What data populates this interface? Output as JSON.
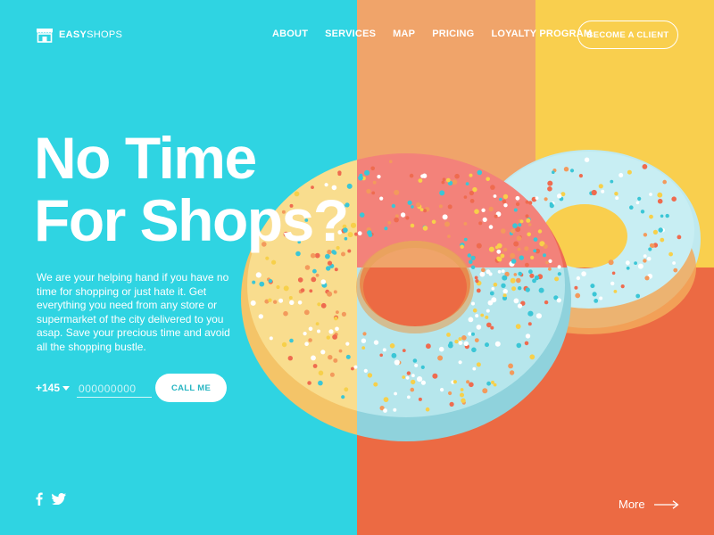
{
  "brand": {
    "name_bold": "EASY",
    "name_light": "SHOPS",
    "icon": "storefront-icon"
  },
  "nav": {
    "items": [
      {
        "label": "ABOUT"
      },
      {
        "label": "SERVICES"
      },
      {
        "label": "MAP"
      },
      {
        "label": "PRICING"
      },
      {
        "label": "LOYALTY PROGRAM"
      }
    ],
    "cta_label": "BECOME A CLIENT"
  },
  "hero": {
    "title_line1": "No Time",
    "title_line2": "For Shops?",
    "description": "We are your helping hand if you have no time for shopping or just hate it. Get everything you need from any store or supermarket of the city delivered to you asap. Save your precious time and avoid all the shopping bustle."
  },
  "phone": {
    "country_code": "+145",
    "placeholder": "000000000",
    "call_label": "CALL ME"
  },
  "social": {
    "icons": [
      "facebook-icon",
      "twitter-icon"
    ]
  },
  "footer": {
    "more_label": "More",
    "more_icon": "arrow-right-icon"
  },
  "colors": {
    "cyan": "#2fd4e2",
    "peach": "#f0a46a",
    "yellow": "#f9cf4e",
    "red": "#ec6a43",
    "button_text": "#27b5c2"
  }
}
